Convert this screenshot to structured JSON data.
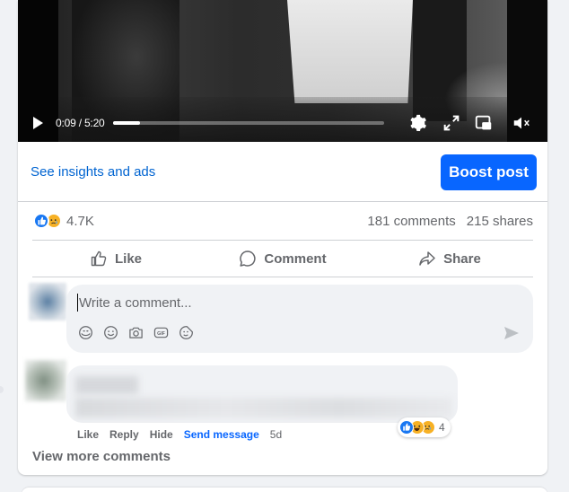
{
  "video": {
    "time": "0:09 / 5:20",
    "progress_fraction": 0.1
  },
  "post": {
    "insights_label": "See insights and ads",
    "boost_label": "Boost post",
    "reaction_count": "4.7K",
    "comments_count": "181 comments",
    "shares_count": "215 shares"
  },
  "actions": {
    "like": "Like",
    "comment": "Comment",
    "share": "Share"
  },
  "composer": {
    "placeholder": "Write a comment...",
    "tools": [
      "avatar-sticker-icon",
      "emoji-icon",
      "camera-icon",
      "gif-icon",
      "sticker-icon"
    ]
  },
  "comment": {
    "reaction_count": "4",
    "like": "Like",
    "reply": "Reply",
    "hide": "Hide",
    "send_message": "Send message",
    "time": "5d"
  },
  "view_more": "View more comments",
  "colors": {
    "primary": "#0866ff",
    "link": "#0064d1",
    "secondary_text": "#65676b",
    "bubble": "#f0f2f5"
  }
}
